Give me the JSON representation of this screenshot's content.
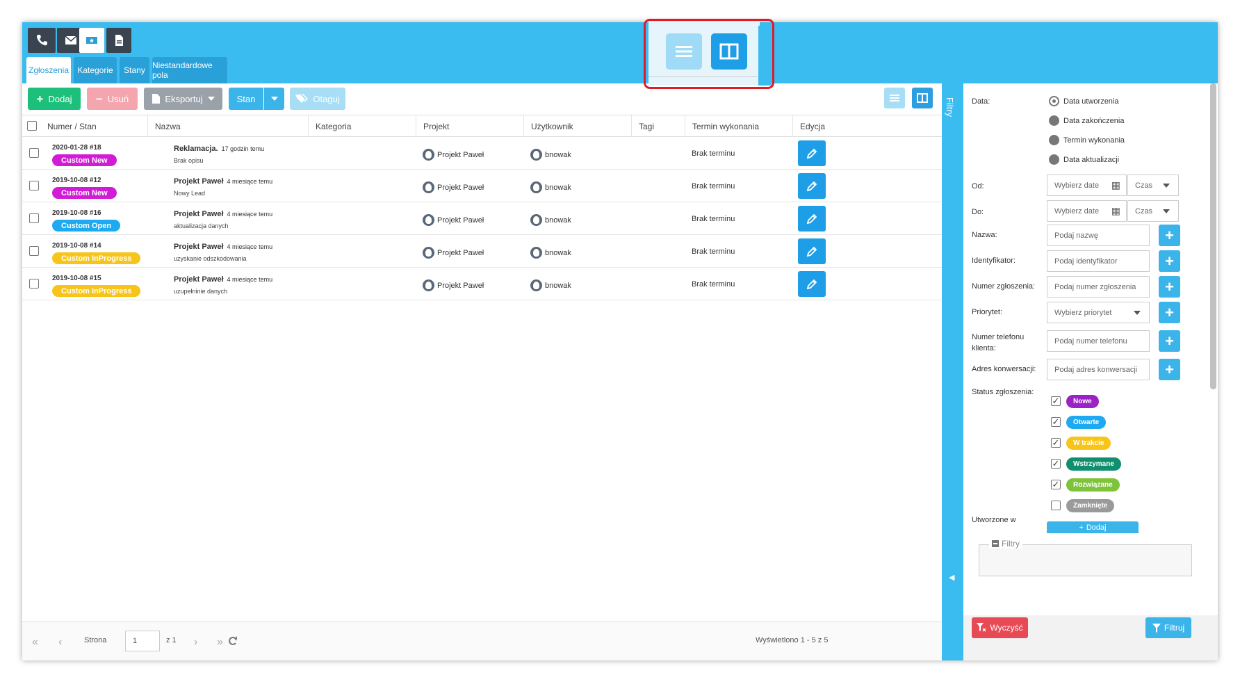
{
  "top_icons": [
    "phone-icon",
    "envelope-icon",
    "ticket-icon",
    "document-icon"
  ],
  "tabs": [
    "Zgłoszenia",
    "Kategorie",
    "Stany",
    "Niestandardowe pola"
  ],
  "toolbar": {
    "add": "Dodaj",
    "delete": "Usuń",
    "export": "Eksportuj",
    "state": "Stan",
    "tag": "Otaguj"
  },
  "columns": [
    "Numer / Stan",
    "Nazwa",
    "Kategoria",
    "Projekt",
    "Użytkownik",
    "Tagi",
    "Termin wykonania",
    "Edycja"
  ],
  "rows": [
    {
      "number": "2020-01-28 #18",
      "status": "Custom New",
      "status_color": "#d21bd6",
      "title": "Reklamacja.",
      "time": "17 godzin temu",
      "desc": "Brak opisu",
      "project": "Projekt Paweł",
      "user": "bnowak",
      "deadline": "Brak terminu"
    },
    {
      "number": "2019-10-08 #12",
      "status": "Custom New",
      "status_color": "#d21bd6",
      "title": "Projekt Paweł",
      "time": "4 miesiące temu",
      "desc": "Nowy Lead",
      "project": "Projekt Paweł",
      "user": "bnowak",
      "deadline": "Brak terminu"
    },
    {
      "number": "2019-10-08 #16",
      "status": "Custom Open",
      "status_color": "#1eaaf0",
      "title": "Projekt Paweł",
      "time": "4 miesiące temu",
      "desc": "aktualizacja danych",
      "project": "Projekt Paweł",
      "user": "bnowak",
      "deadline": "Brak terminu"
    },
    {
      "number": "2019-10-08 #14",
      "status": "Custom InProgress",
      "status_color": "#f7c51a",
      "title": "Projekt Paweł",
      "time": "4 miesiące temu",
      "desc": "uzyskanie odszkodowania",
      "project": "Projekt Paweł",
      "user": "bnowak",
      "deadline": "Brak terminu"
    },
    {
      "number": "2019-10-08 #15",
      "status": "Custom InProgress",
      "status_color": "#f7c51a",
      "title": "Projekt Paweł",
      "time": "4 miesiące temu",
      "desc": "uzupełninie danych",
      "project": "Projekt Paweł",
      "user": "bnowak",
      "deadline": "Brak terminu"
    }
  ],
  "pager": {
    "page_label": "Strona",
    "page_value": "1",
    "of": "z 1",
    "displayed": "Wyświetlono 1 - 5 z 5"
  },
  "filters_tab": "Filtry",
  "filters": {
    "date_label": "Data:",
    "date_options": [
      "Data utworzenia",
      "Data zakończenia",
      "Termin wykonania",
      "Data aktualizacji"
    ],
    "from_label": "Od:",
    "to_label": "Do:",
    "date_placeholder": "Wybierz date",
    "time_placeholder": "Czas",
    "name_label": "Nazwa:",
    "name_placeholder": "Podaj nazwę",
    "id_label": "Identyfikator:",
    "id_placeholder": "Podaj identyfikator",
    "number_label": "Numer zgłoszenia:",
    "number_placeholder": "Podaj numer zgłoszenia",
    "priority_label": "Priorytet:",
    "priority_placeholder": "Wybierz priorytet",
    "phone_label": "Numer telefonu klienta:",
    "phone_placeholder": "Podaj numer telefonu",
    "conv_label": "Adres konwersacji:",
    "conv_placeholder": "Podaj adres konwersacji",
    "status_label": "Status zgłoszenia:",
    "statuses": [
      {
        "label": "Nowe",
        "color": "#9b22c4",
        "checked": true
      },
      {
        "label": "Otwarte",
        "color": "#1eaaf0",
        "checked": true
      },
      {
        "label": "W trakcie",
        "color": "#f7c51a",
        "checked": true
      },
      {
        "label": "Wstrzymane",
        "color": "#0f8f6e",
        "checked": true
      },
      {
        "label": "Rozwiązane",
        "color": "#7dc43a",
        "checked": true
      },
      {
        "label": "Zamknięte",
        "color": "#9a9a9a",
        "checked": false
      }
    ],
    "created_in_label": "Utworzone w",
    "created_in_add": "Dodaj",
    "box_legend": "Filtry",
    "clear": "Wyczyść",
    "apply": "Filtruj"
  }
}
